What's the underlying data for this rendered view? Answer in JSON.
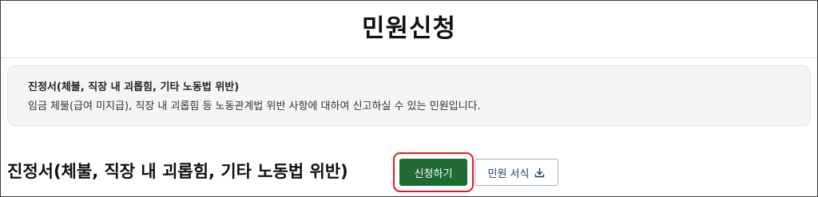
{
  "page": {
    "title": "민원신청"
  },
  "info_box": {
    "title": "진정서(체불, 직장 내 괴롭힘, 기타 노동법 위반)",
    "description": "임금 체불(급여 미지급), 직장 내 괴롭힘 등 노동관계법 위반 사항에 대하여 신고하실 수 있는 민원입니다."
  },
  "petition": {
    "heading": "진정서(체불, 직장 내 괴롭힘, 기타 노동법 위반)",
    "apply_label": "신청하기",
    "form_label": "민원 서식",
    "form_icon": "download-icon"
  },
  "colors": {
    "apply_button": "#1f6b33",
    "highlight_border": "#e01b22",
    "form_button_text": "#1b3a5c",
    "info_box_bg": "#f5f5f5"
  }
}
